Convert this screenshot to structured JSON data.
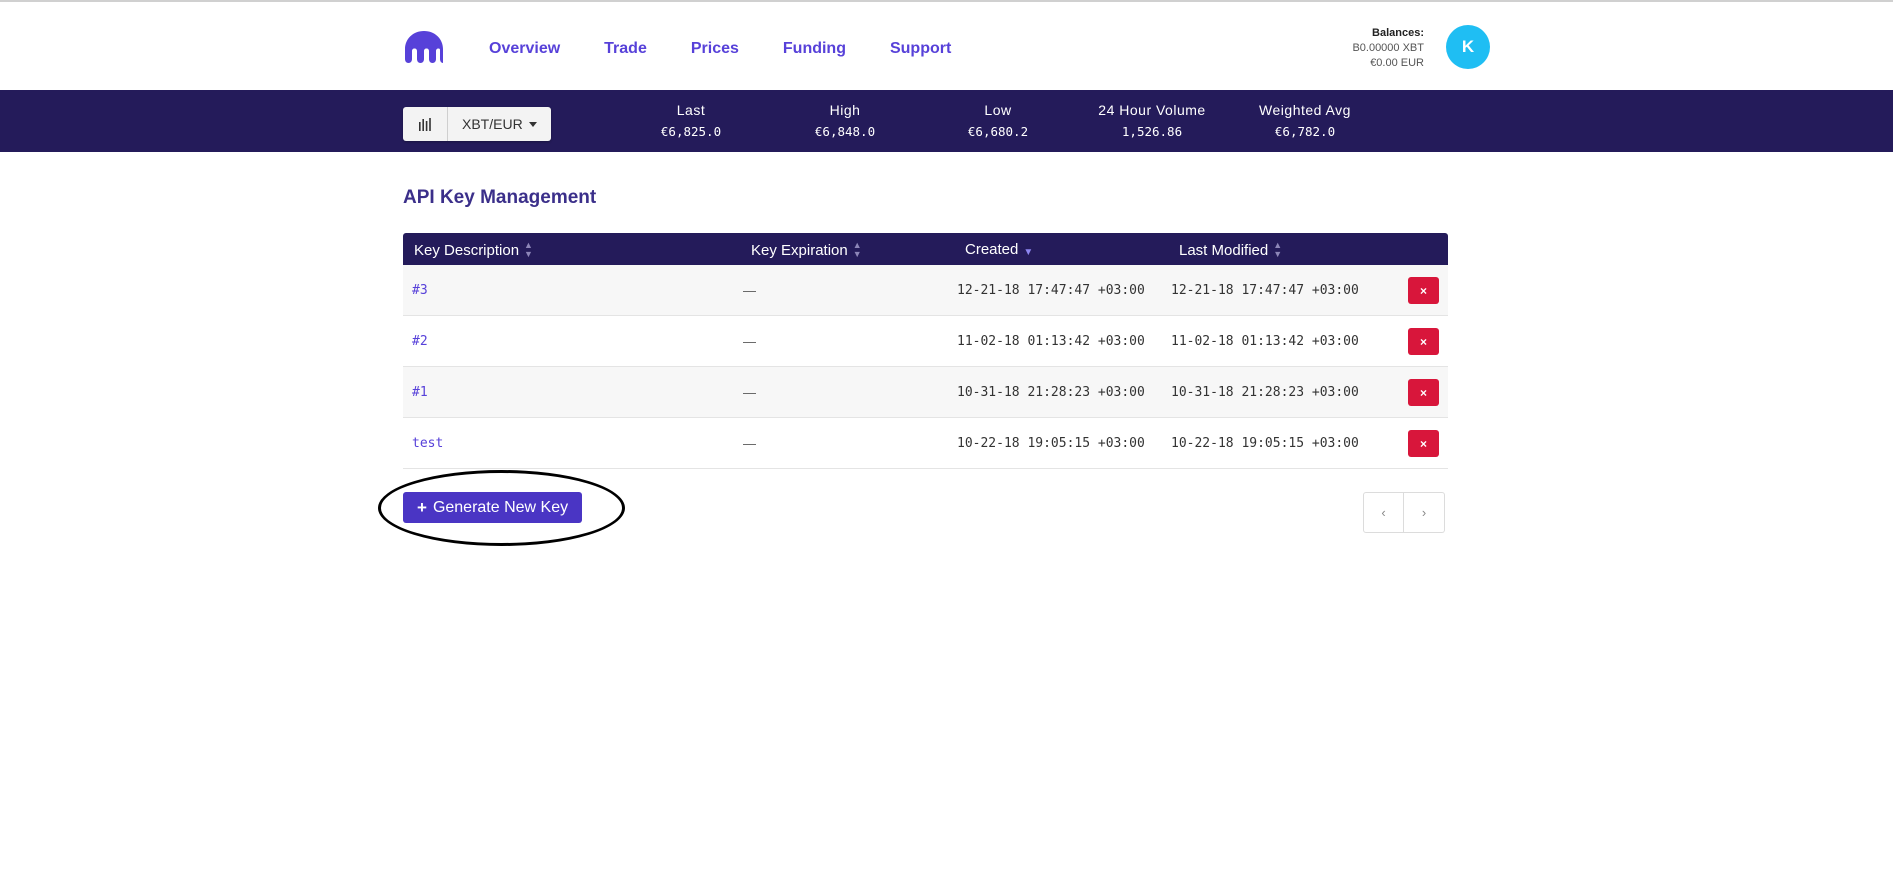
{
  "header": {
    "nav": [
      {
        "label": "Overview"
      },
      {
        "label": "Trade"
      },
      {
        "label": "Prices"
      },
      {
        "label": "Funding"
      },
      {
        "label": "Support"
      }
    ],
    "balances": {
      "title": "Balances:",
      "xbt": "B0.00000 XBT",
      "eur": "€0.00 EUR"
    },
    "avatar_initial": "K",
    "colors": {
      "nav": "#5741d9",
      "avatar": "#1fbef3"
    }
  },
  "ticker": {
    "pair": "XBT/EUR",
    "stats": [
      {
        "label": "Last",
        "value": "€6,825.0"
      },
      {
        "label": "High",
        "value": "€6,848.0"
      },
      {
        "label": "Low",
        "value": "€6,680.2"
      },
      {
        "label": "24 Hour Volume",
        "value": "1,526.86"
      },
      {
        "label": "Weighted Avg",
        "value": "€6,782.0"
      }
    ],
    "colors": {
      "bar": "#241b5a"
    }
  },
  "main": {
    "title": "API Key Management",
    "table": {
      "columns": [
        "Key Description",
        "Key Expiration",
        "Created",
        "Last Modified"
      ],
      "rows": [
        {
          "description": "#3",
          "expiration": "—",
          "created": "12-21-18 17:47:47 +03:00",
          "modified": "12-21-18 17:47:47 +03:00"
        },
        {
          "description": "#2",
          "expiration": "—",
          "created": "11-02-18 01:13:42 +03:00",
          "modified": "11-02-18 01:13:42 +03:00"
        },
        {
          "description": "#1",
          "expiration": "—",
          "created": "10-31-18 21:28:23 +03:00",
          "modified": "10-31-18 21:28:23 +03:00"
        },
        {
          "description": "test",
          "expiration": "—",
          "created": "10-22-18 19:05:15 +03:00",
          "modified": "10-22-18 19:05:15 +03:00"
        }
      ],
      "delete_icon": "×"
    },
    "generate_button": {
      "icon": "+",
      "label": "Generate New Key"
    },
    "pager": {
      "prev": "‹",
      "next": "›"
    },
    "colors": {
      "delete": "#d8163b",
      "generate": "#4a35c4"
    }
  }
}
